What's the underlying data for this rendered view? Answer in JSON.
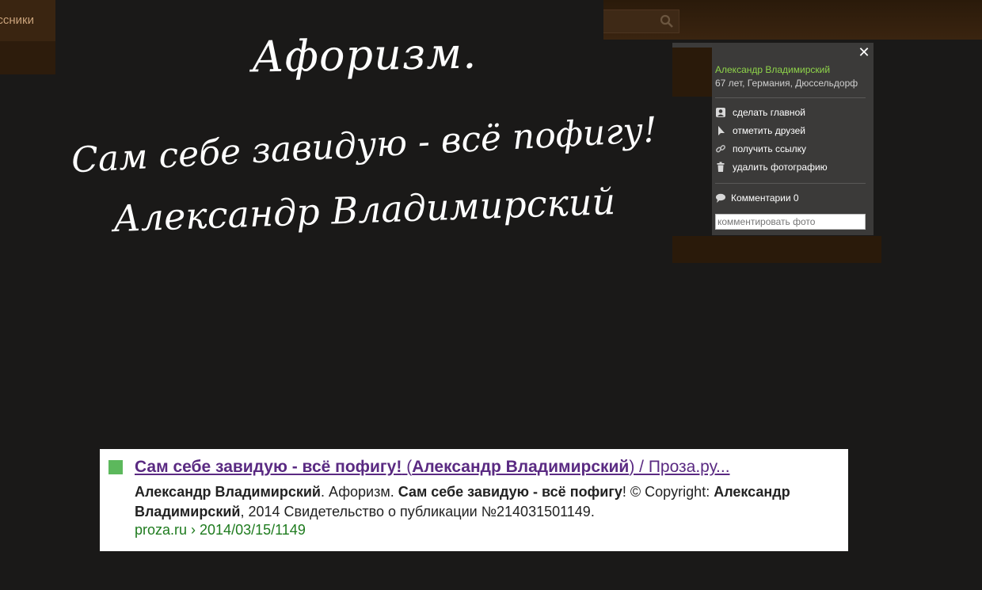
{
  "background_nav": {
    "item_label": "ассники"
  },
  "aphorism": {
    "line1": "Афоризм.",
    "line2": "Сам себе завидую - всё пофигу!",
    "line3": "Александр Владимирский"
  },
  "panel": {
    "close_symbol": "✕",
    "author_name": "Александр Владимирский",
    "author_info": "67 лет, Германия, Дюссельдорф",
    "actions": [
      {
        "label": "сделать главной",
        "icon": "user-card-icon"
      },
      {
        "label": "отметить друзей",
        "icon": "cursor-icon"
      },
      {
        "label": "получить ссылку",
        "icon": "link-icon"
      },
      {
        "label": "удалить фотографию",
        "icon": "trash-icon"
      }
    ],
    "comments_label": "Комментарии 0",
    "comment_placeholder": "комментировать фото",
    "accent_color": "#8fd44a"
  },
  "search_result": {
    "title_part1": "Сам себе завидую - всё пофигу!",
    "title_part2": " (",
    "title_part3": "Александр Владимирский",
    "title_part4": ") / Проза.ру...",
    "snippet_bold1": "Александр Владимирский",
    "snippet_text1": ". Афоризм. ",
    "snippet_bold2": "Сам себе завидую - всё пофигу",
    "snippet_text2": "! © Copyright: ",
    "snippet_bold3": "Александр Владимирский",
    "snippet_text3": ", 2014 Свидетельство о публикации №214031501149.",
    "url": "proza.ru › 2014/03/15/1149",
    "link_color": "#5a2a82",
    "url_color": "#1e7b1e"
  }
}
